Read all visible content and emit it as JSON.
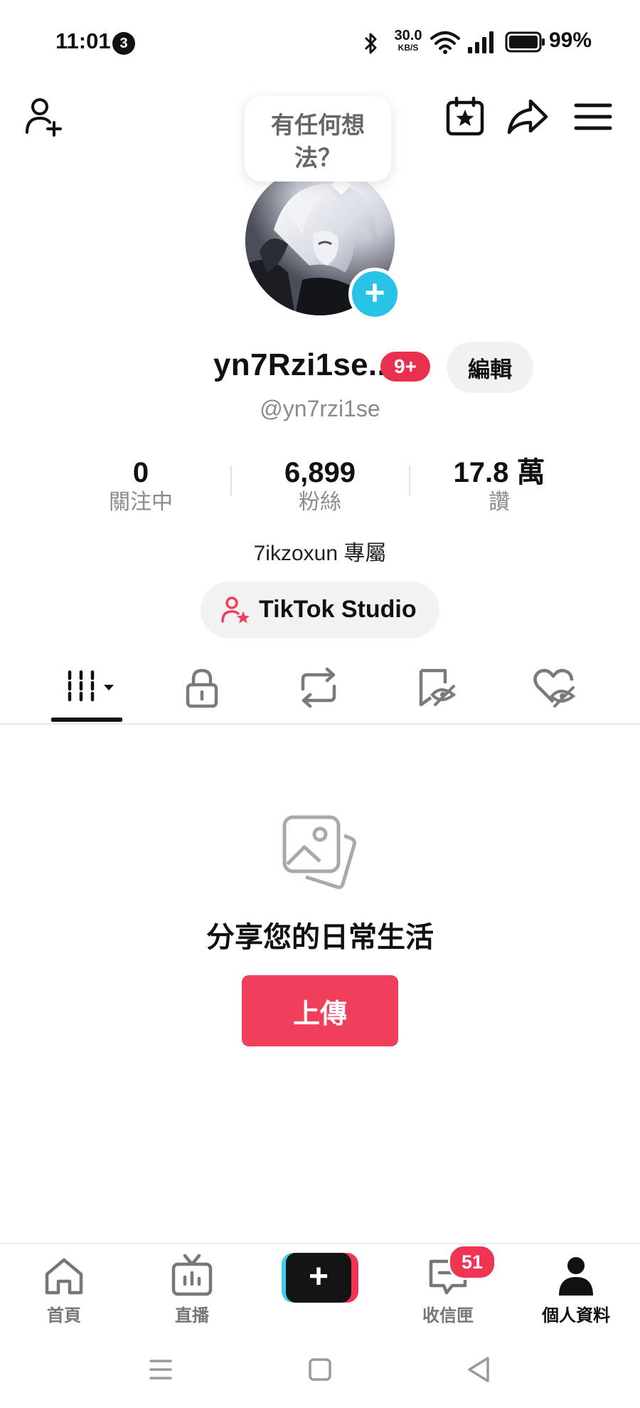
{
  "status_bar": {
    "time": "11:01",
    "notification_count": "3",
    "net_speed_value": "30.0",
    "net_speed_unit": "KB/S",
    "battery": "99%"
  },
  "header": {
    "bubble_text": "有任何想法？"
  },
  "profile": {
    "username": "yn7Rzi1se..",
    "badge": "9+",
    "edit_label": "編輯",
    "handle": "@yn7rzi1se",
    "stats": [
      {
        "value": "0",
        "label": "關注中"
      },
      {
        "value": "6,899",
        "label": "粉絲"
      },
      {
        "value": "17.8 萬",
        "label": "讚"
      }
    ],
    "bio": "7ikzoxun 專屬",
    "studio_label": "TikTok Studio"
  },
  "tabs": {
    "icons": [
      "videos-grid-icon",
      "lock-icon",
      "repost-icon",
      "hidden-bookmark-icon",
      "hidden-heart-icon"
    ],
    "active": 0
  },
  "empty_state": {
    "title": "分享您的日常生活",
    "upload_label": "上傳"
  },
  "bottom_nav": {
    "items": [
      {
        "label": "首頁",
        "icon": "home-icon"
      },
      {
        "label": "直播",
        "icon": "live-tv-icon"
      },
      {
        "label": "",
        "icon": "create-plus-icon"
      },
      {
        "label": "收信匣",
        "icon": "inbox-icon"
      },
      {
        "label": "個人資料",
        "icon": "profile-icon"
      }
    ],
    "inbox_badge": "51",
    "active": 4
  },
  "colors": {
    "accent_red": "#ef3f5c",
    "badge_red": "#e8304f",
    "avatar_add": "#28c2e8",
    "create_cyan": "#3ad0e6"
  }
}
